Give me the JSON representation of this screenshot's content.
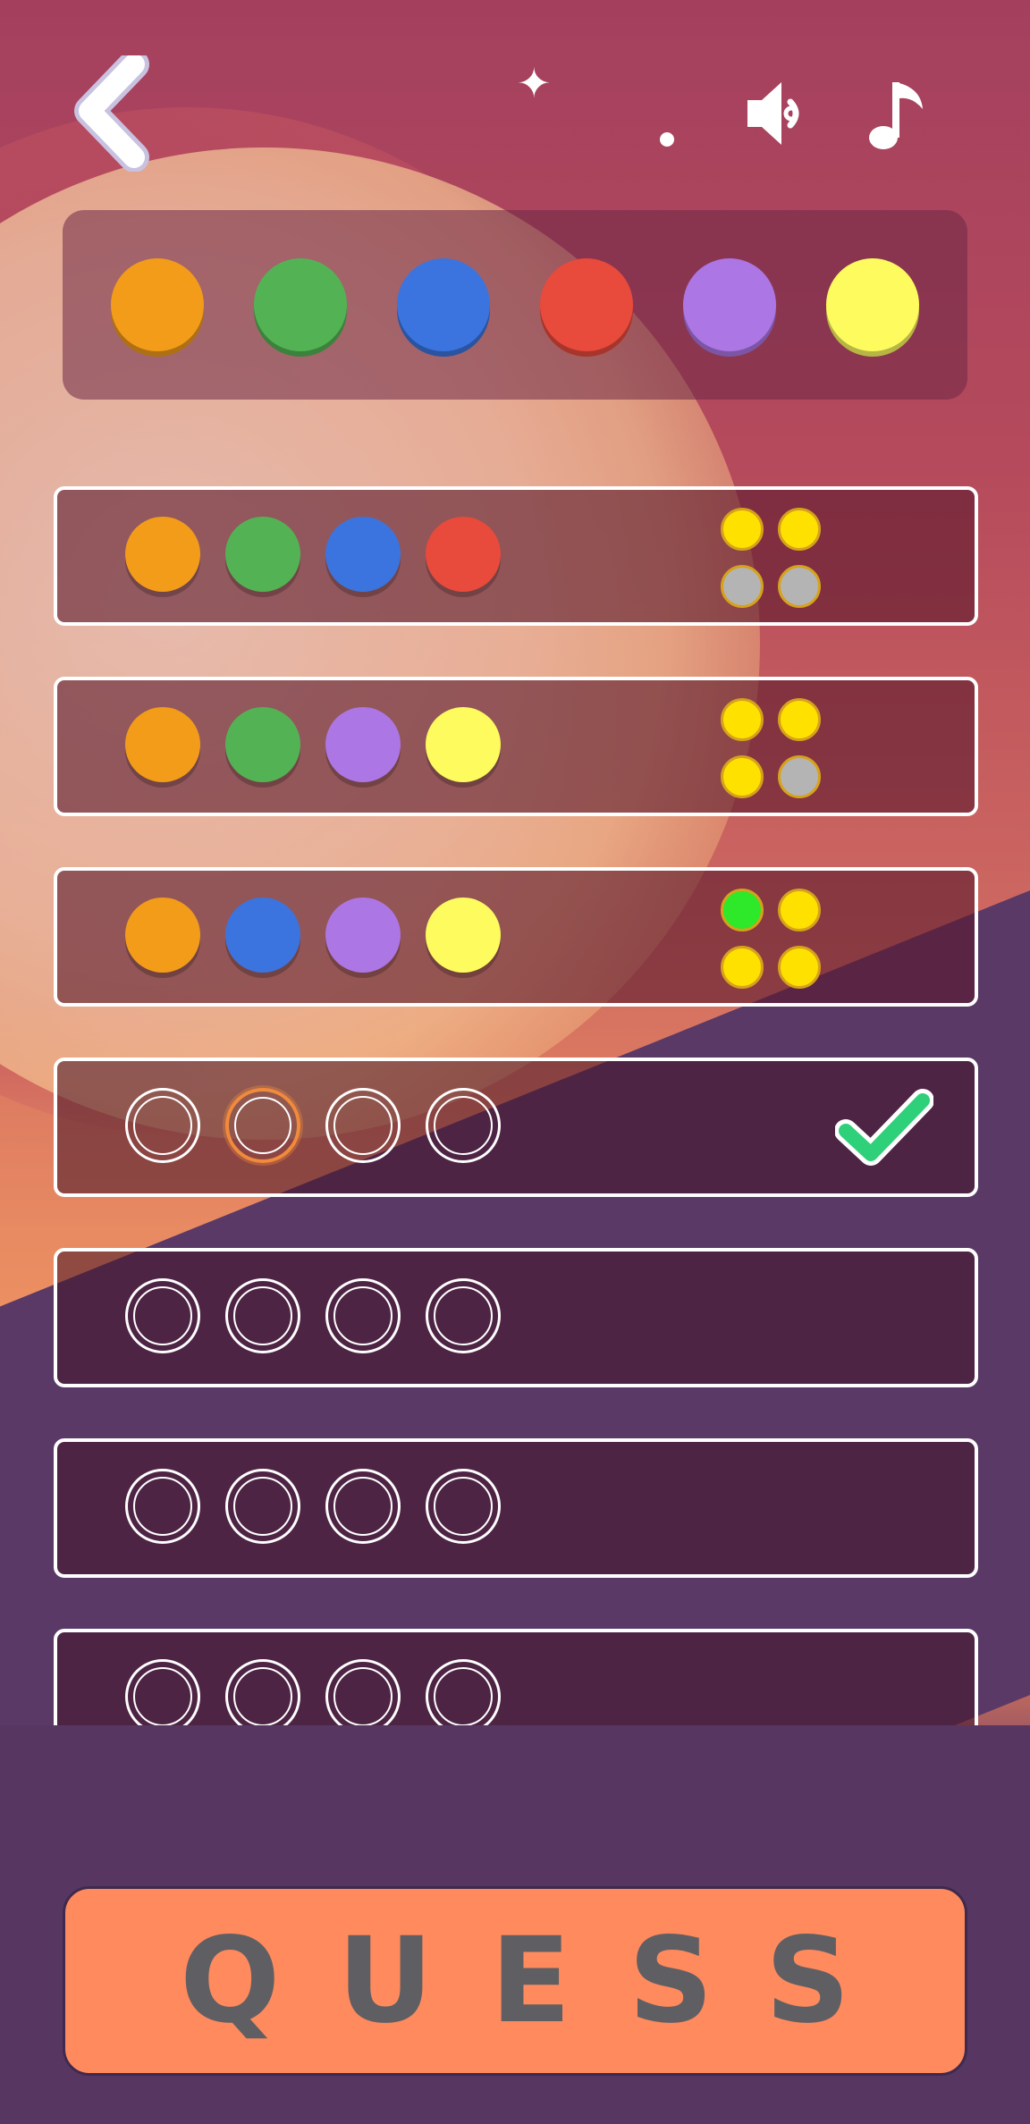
{
  "palette": [
    {
      "name": "orange",
      "color": "#f39c1a"
    },
    {
      "name": "green",
      "color": "#53b354"
    },
    {
      "name": "blue",
      "color": "#3b74de"
    },
    {
      "name": "red",
      "color": "#e84a3c"
    },
    {
      "name": "purple",
      "color": "#ad76e5"
    },
    {
      "name": "yellow",
      "color": "#fefb5f"
    }
  ],
  "hint_colors": {
    "exact": "#2ee82a",
    "present": "#ffe100",
    "absent": "#b4b4b4"
  },
  "rows": [
    {
      "pegs": [
        "#f39c1a",
        "#53b354",
        "#3b74de",
        "#e84a3c"
      ],
      "hints": [
        "present",
        "present",
        "absent",
        "absent"
      ],
      "active": false
    },
    {
      "pegs": [
        "#f39c1a",
        "#53b354",
        "#ad76e5",
        "#fefb5f"
      ],
      "hints": [
        "present",
        "present",
        "present",
        "absent"
      ],
      "active": false
    },
    {
      "pegs": [
        "#f39c1a",
        "#3b74de",
        "#ad76e5",
        "#fefb5f"
      ],
      "hints": [
        "exact",
        "present",
        "present",
        "present"
      ],
      "active": false
    },
    {
      "pegs": [
        null,
        null,
        null,
        null
      ],
      "hints": [],
      "active": true,
      "selected_slot": 1
    },
    {
      "pegs": [
        null,
        null,
        null,
        null
      ],
      "hints": [],
      "active": false
    },
    {
      "pegs": [
        null,
        null,
        null,
        null
      ],
      "hints": [],
      "active": false
    },
    {
      "pegs": [
        null,
        null,
        null,
        null
      ],
      "hints": [],
      "active": false
    }
  ],
  "icons": {
    "back": "back-chevron-icon",
    "sound": "speaker-icon",
    "music": "music-note-icon",
    "check": "checkmark-icon"
  },
  "guess_button": {
    "label": "QUESS"
  }
}
